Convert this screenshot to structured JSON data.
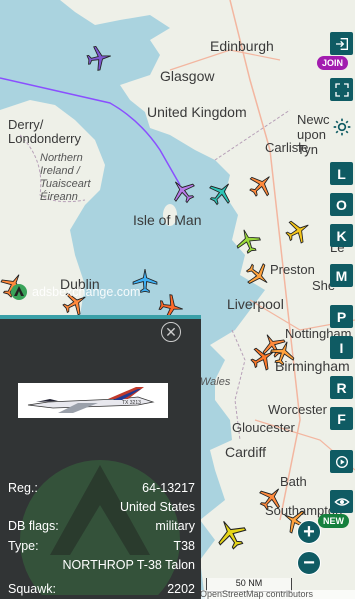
{
  "map": {
    "labels": [
      "Edinburgh",
      "Glasgow",
      "United Kingdom",
      "Derry/",
      "Londonderry",
      "Northern",
      "Ireland /",
      "Tuaisceart",
      "Éireann",
      "Carlisle",
      "Newcastle",
      "Isle of Man",
      "Dublin",
      "Liverpool",
      "Preston",
      "Nottingham",
      "Birmingham",
      "Wales",
      "Worcester",
      "Gloucester",
      "Cardiff",
      "Bath",
      "Southampton"
    ],
    "partial_labels": [
      "Newc",
      "upon",
      "Tyn",
      "She",
      "Le"
    ]
  },
  "watermark": {
    "logo_text": "adsbexchange.com"
  },
  "toolbar": {
    "letters": [
      "L",
      "O",
      "K",
      "M",
      "P",
      "I",
      "R",
      "F"
    ],
    "join_badge": "JOIN",
    "new_badge": "NEW",
    "icons": [
      "login-icon",
      "fullscreen-icon",
      "settings-icon",
      "replay-icon",
      "eye-icon"
    ]
  },
  "panel": {
    "close_icon": "close-circle-icon",
    "photo_tail": "TX 3213",
    "rows": [
      {
        "key": "Reg.:",
        "value": "64-13217"
      },
      {
        "key": "",
        "value": "United States"
      },
      {
        "key": "DB flags:",
        "value": "military"
      },
      {
        "key": "Type:",
        "value": "T38"
      },
      {
        "key": "",
        "value": "NORTHROP T-38 Talon"
      },
      {
        "key": "Squawk:",
        "value": "2202"
      }
    ]
  },
  "zoom": {
    "in": "+",
    "out": "−"
  },
  "scale_text": "50 NM",
  "attribution": "OpenStreetMap contributors",
  "colors": {
    "toolbar": "#0f5b63",
    "join_badge": "#a21caf",
    "new_badge": "#15803d",
    "selected_plane": "#9b59d0",
    "track": "#8a4fff"
  }
}
